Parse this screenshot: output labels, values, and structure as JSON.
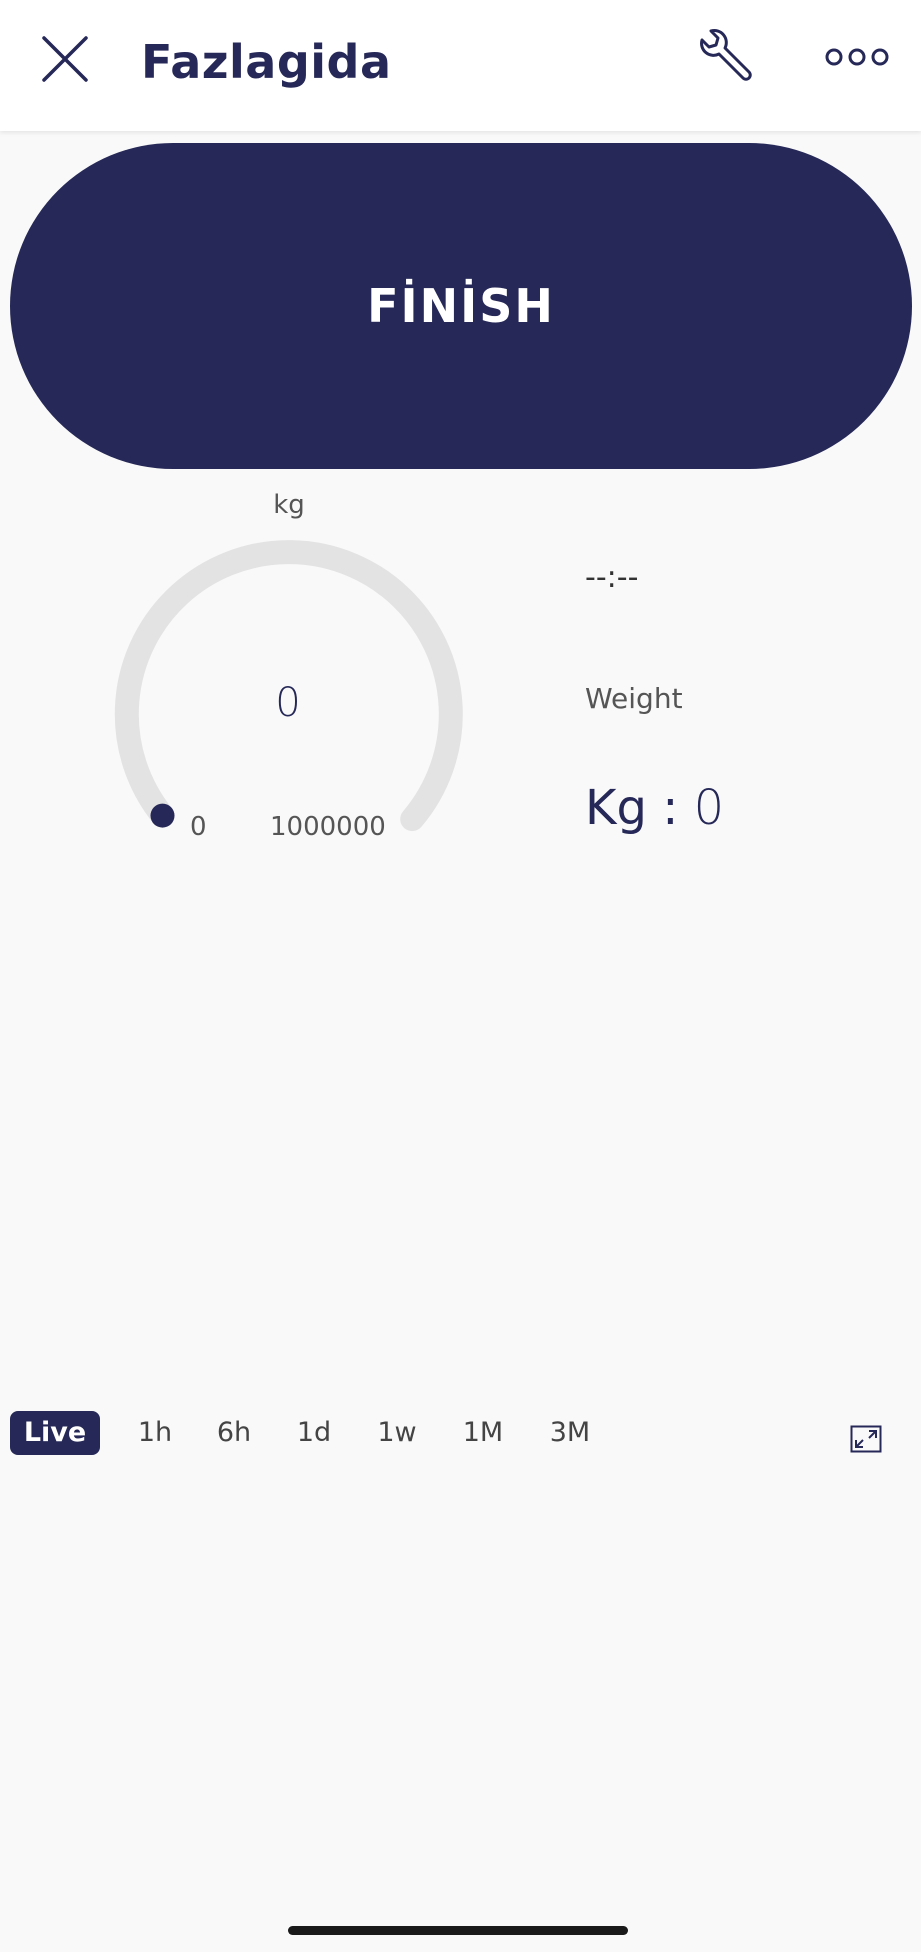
{
  "header": {
    "title": "Fazlagida",
    "close_icon": "close-icon",
    "settings_icon": "wrench-icon",
    "more_icon": "more-horizontal-icon"
  },
  "main": {
    "finish_label": "FİNİSH",
    "gauge": {
      "unit": "kg",
      "value": "0",
      "min": "0",
      "max": "1000000"
    },
    "time": "--:--",
    "weight_label": "Weight",
    "kg_prefix": "Kg : ",
    "kg_value": "0"
  },
  "chart_range": {
    "tabs": [
      "Live",
      "1h",
      "6h",
      "1d",
      "1w",
      "1M",
      "3M"
    ],
    "selected": "Live",
    "expand_icon": "expand-icon"
  },
  "colors": {
    "primary": "#262857",
    "background": "#f9f9f9",
    "gauge_track": "#e3e3e3"
  }
}
